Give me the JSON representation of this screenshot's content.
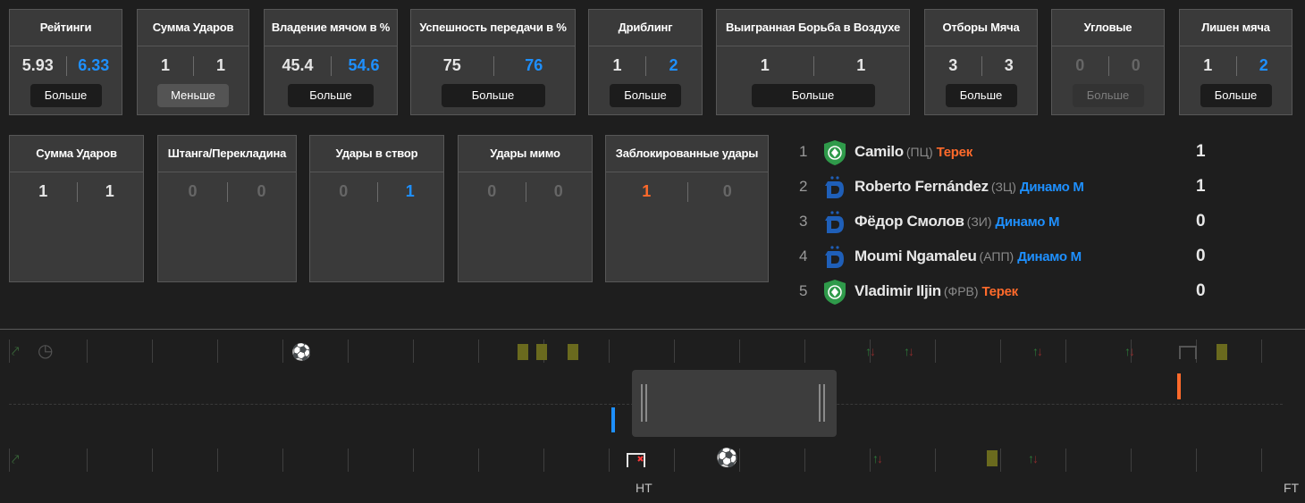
{
  "stats_top": [
    {
      "title": "Рейтинги",
      "home": "5.93",
      "away": "6.33",
      "button": "Больше"
    },
    {
      "title": "Сумма Ударов",
      "home": "1",
      "away": "1",
      "button": "Меньше"
    },
    {
      "title": "Владение мячом в %",
      "home": "45.4",
      "away": "54.6",
      "button": "Больше"
    },
    {
      "title": "Успешность передачи в %",
      "home": "75",
      "away": "76",
      "button": "Больше"
    },
    {
      "title": "Дриблинг",
      "home": "1",
      "away": "2",
      "button": "Больше"
    },
    {
      "title": "Выигранная Борьба в Воздухе",
      "home": "1",
      "away": "1",
      "button": "Больше"
    },
    {
      "title": "Отборы Мяча",
      "home": "3",
      "away": "3",
      "button": "Больше"
    },
    {
      "title": "Угловые",
      "home": "0",
      "away": "0",
      "button": "Больше"
    },
    {
      "title": "Лишен мяча",
      "home": "1",
      "away": "2",
      "button": "Больше"
    }
  ],
  "stats_shots": [
    {
      "title": "Сумма Ударов",
      "home": "1",
      "away": "1"
    },
    {
      "title": "Штанга/Перекладина",
      "home": "0",
      "away": "0"
    },
    {
      "title": "Удары в створ",
      "home": "0",
      "away": "1"
    },
    {
      "title": "Удары мимо",
      "home": "0",
      "away": "0"
    },
    {
      "title": "Заблокированные удары",
      "home": "1",
      "away": "0"
    }
  ],
  "players": [
    {
      "rank": "1",
      "name": "Camilo",
      "pos": "(ПЦ)",
      "team": "Терек",
      "team_color": "#ff6a2b",
      "crest": "terek-crest-icon",
      "score": "1"
    },
    {
      "rank": "2",
      "name": "Roberto Fernández",
      "pos": "(ЗЦ)",
      "team": "Динамо М",
      "team_color": "#1e90ff",
      "crest": "dinamo-crest-icon",
      "score": "1"
    },
    {
      "rank": "3",
      "name": "Фёдор Смолов",
      "pos": "(ЗИ)",
      "team": "Динамо М",
      "team_color": "#1e90ff",
      "crest": "dinamo-crest-icon",
      "score": "0"
    },
    {
      "rank": "4",
      "name": "Moumi Ngamaleu",
      "pos": "(АПП)",
      "team": "Динамо М",
      "team_color": "#1e90ff",
      "crest": "dinamo-crest-icon",
      "score": "0"
    },
    {
      "rank": "5",
      "name": "Vladimir Iljin",
      "pos": "(ФРВ)",
      "team": "Терек",
      "team_color": "#ff6a2b",
      "crest": "terek-crest-icon",
      "score": "0"
    }
  ],
  "timeline": {
    "ht_label": "HT",
    "ft_label": "FT"
  },
  "colors": {
    "home": "#e6e6e6",
    "away": "#1e90ff",
    "highlight": "#ff6a2b",
    "terek_green": "#2f9a4a",
    "dinamo_blue": "#1f5fb8"
  }
}
